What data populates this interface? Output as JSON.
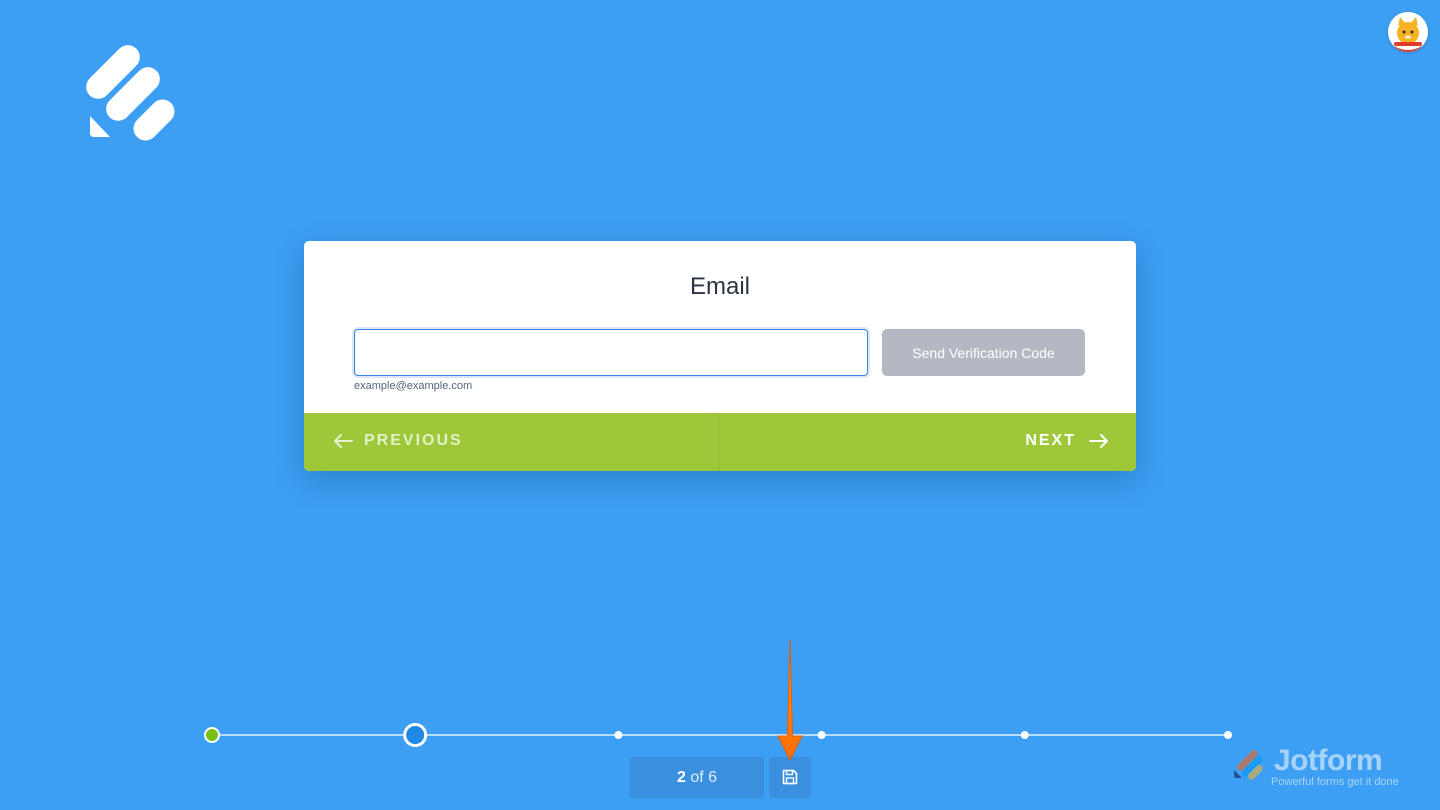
{
  "form": {
    "question_label": "Email",
    "email_value": "",
    "email_sublabel": "example@example.com",
    "verify_button_label": "Send Verification Code"
  },
  "navigation": {
    "previous_label": "PREVIOUS",
    "next_label": "NEXT"
  },
  "progress": {
    "current_page": "2",
    "of_total": " of 6",
    "total_pages": 6,
    "completed_steps": 1
  },
  "branding": {
    "name": "Jotform",
    "tagline": "Powerful forms get it done"
  },
  "colors": {
    "background": "#3c9ff3",
    "nav_bar": "#9ec83a",
    "verify_button": "#b3b8c2",
    "completed_step": "#78c015",
    "current_step": "#1e88e5",
    "pointer_arrow": "#ff7a00"
  },
  "icons": {
    "logo": "app-logo-icon",
    "avatar": "user-avatar-icon",
    "previous": "arrow-left-icon",
    "next": "arrow-right-icon",
    "save": "floppy-disk-icon",
    "pointer": "arrow-down-pointer-icon"
  }
}
